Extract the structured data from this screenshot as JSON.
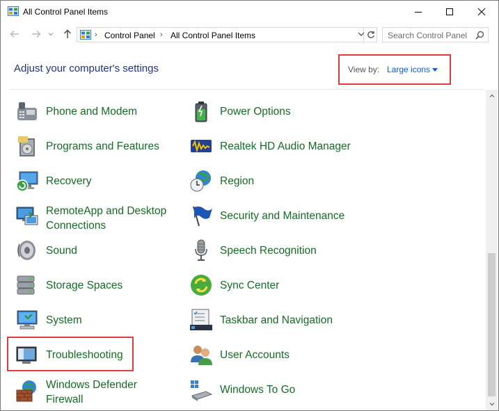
{
  "window": {
    "title": "All Control Panel Items"
  },
  "nav": {
    "breadcrumb": [
      "Control Panel",
      "All Control Panel Items"
    ],
    "search_placeholder": "Search Control Panel"
  },
  "header": {
    "heading": "Adjust your computer's settings",
    "view_by_label": "View by:",
    "view_by_value": "Large icons"
  },
  "items_left": [
    {
      "label": "Phone and Modem",
      "icon": "phone-modem-icon"
    },
    {
      "label": "Programs and Features",
      "icon": "programs-features-icon"
    },
    {
      "label": "Recovery",
      "icon": "recovery-icon"
    },
    {
      "label": "RemoteApp and Desktop",
      "label2": "Connections",
      "icon": "remoteapp-icon"
    },
    {
      "label": "Sound",
      "icon": "speaker-icon"
    },
    {
      "label": "Storage Spaces",
      "icon": "storage-spaces-icon"
    },
    {
      "label": "System",
      "icon": "system-computer-icon"
    },
    {
      "label": "Troubleshooting",
      "icon": "troubleshooting-icon"
    },
    {
      "label": "Windows Defender",
      "label2": "Firewall",
      "icon": "firewall-icon"
    }
  ],
  "items_right": [
    {
      "label": "Power Options",
      "icon": "battery-icon"
    },
    {
      "label": "Realtek HD Audio Manager",
      "icon": "realtek-audio-icon"
    },
    {
      "label": "Region",
      "icon": "globe-clock-icon"
    },
    {
      "label": "Security and Maintenance",
      "icon": "flag-icon"
    },
    {
      "label": "Speech Recognition",
      "icon": "microphone-icon"
    },
    {
      "label": "Sync Center",
      "icon": "sync-icon"
    },
    {
      "label": "Taskbar and Navigation",
      "icon": "taskbar-icon"
    },
    {
      "label": "User Accounts",
      "icon": "user-accounts-icon"
    },
    {
      "label": "Windows To Go",
      "icon": "usb-drive-icon"
    }
  ],
  "colors": {
    "link_green": "#166b24",
    "heading_blue": "#1e3287",
    "accent_blue": "#0c5bd3",
    "highlight_red": "#e03c3c"
  }
}
